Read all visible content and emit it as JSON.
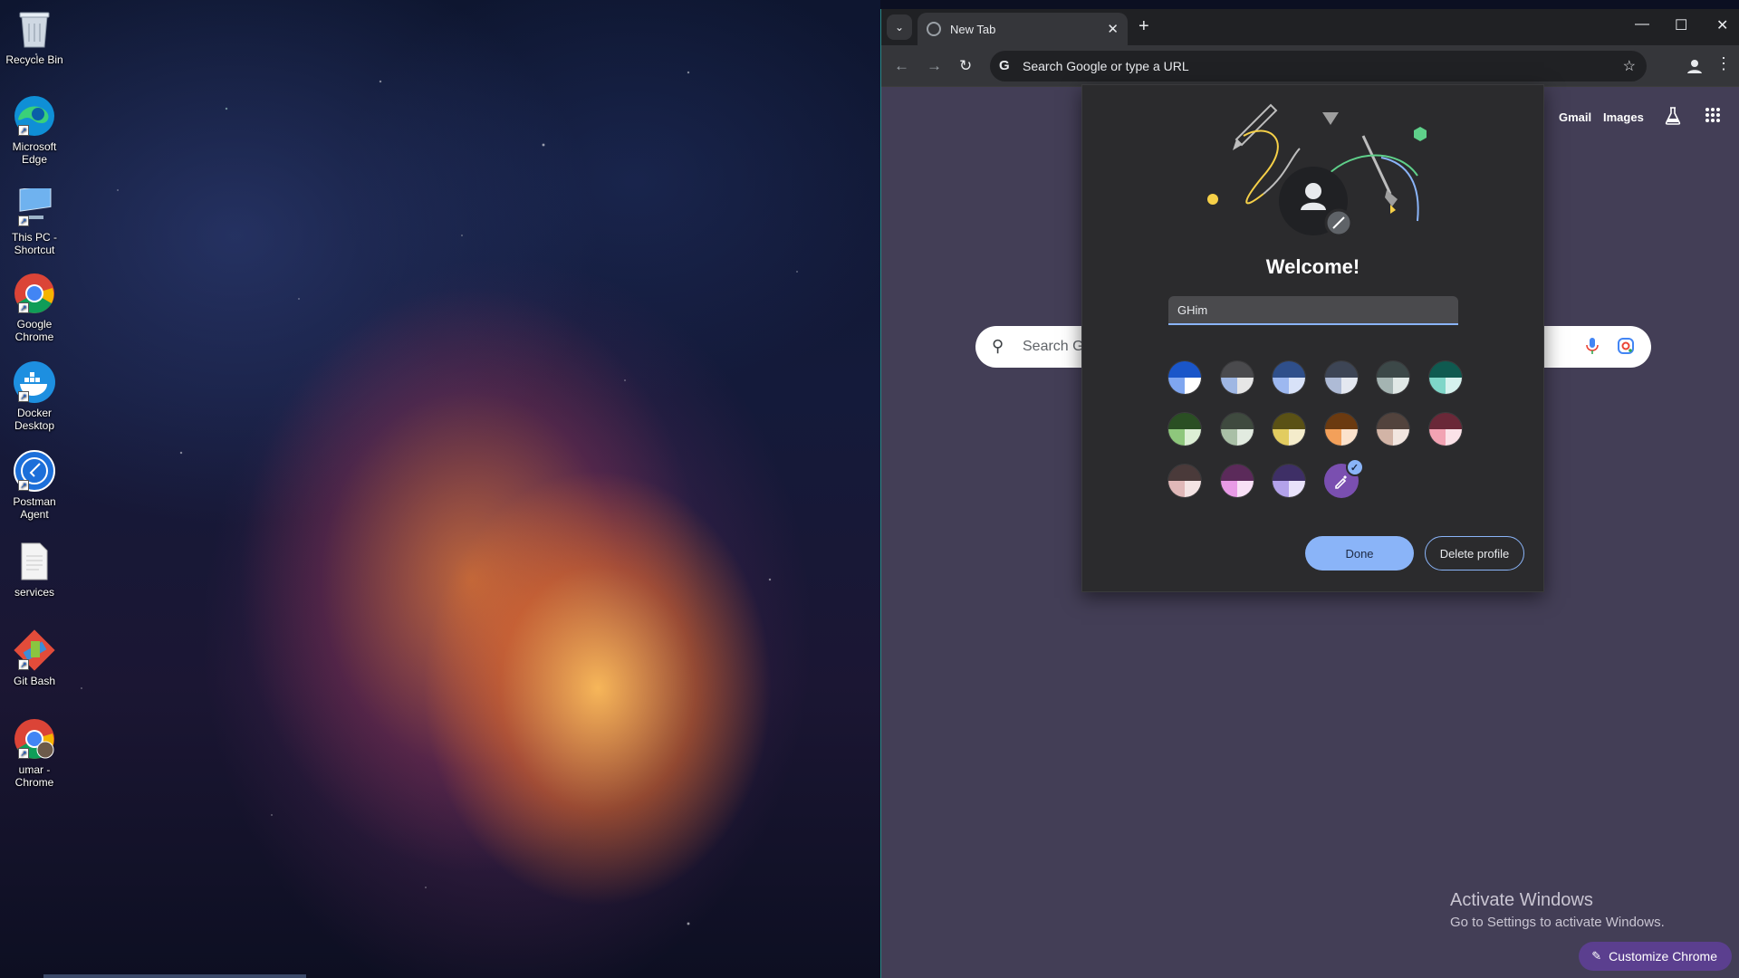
{
  "desktop": {
    "icons": [
      {
        "label": "Recycle Bin",
        "icon": "recycle-bin-icon"
      },
      {
        "label": "Microsoft Edge",
        "icon": "edge-icon"
      },
      {
        "label": "This PC - Shortcut",
        "icon": "computer-icon"
      },
      {
        "label": "Google Chrome",
        "icon": "chrome-icon"
      },
      {
        "label": "Docker Desktop",
        "icon": "docker-icon"
      },
      {
        "label": "Postman Agent",
        "icon": "postman-icon"
      },
      {
        "label": "services",
        "icon": "text-file-icon"
      },
      {
        "label": "Git Bash",
        "icon": "git-icon"
      },
      {
        "label": "umar - Chrome",
        "icon": "chrome-profile-icon"
      }
    ],
    "activate_windows": {
      "title": "Activate Windows",
      "subtitle": "Go to Settings to activate Windows."
    }
  },
  "browser": {
    "tab": {
      "title": "New Tab",
      "close": "✕"
    },
    "new_tab": "+",
    "window_controls": {
      "minimize": "—",
      "maximize": "☐",
      "close": "✕"
    },
    "omnibox": {
      "placeholder": "Search Google or type a URL"
    },
    "ntp": {
      "links": [
        "Gmail",
        "Images"
      ],
      "search_placeholder": "Search G",
      "customize_label": "Customize Chrome"
    }
  },
  "profile_dialog": {
    "title": "Welcome!",
    "name_value": "GHim",
    "color_swatches": [
      {
        "top": "#1a56c9",
        "bl": "#7fa6f0",
        "br": "#ffffff"
      },
      {
        "top": "#4a4a4d",
        "bl": "#9fb7e3",
        "br": "#e6e6e6"
      },
      {
        "top": "#2f4f8a",
        "bl": "#9db8f0",
        "br": "#d8e2f8"
      },
      {
        "top": "#3d4555",
        "bl": "#aebbd6",
        "br": "#e4e8f0"
      },
      {
        "top": "#3c4848",
        "bl": "#a4b4b2",
        "br": "#e0e8e6"
      },
      {
        "top": "#0f5a50",
        "bl": "#7fd6c8",
        "br": "#d6f2ee"
      },
      {
        "top": "#2a4f23",
        "bl": "#8ec77c",
        "br": "#dcefd5"
      },
      {
        "top": "#3f4a3f",
        "bl": "#a9bfa6",
        "br": "#e2ebe0"
      },
      {
        "top": "#5a5115",
        "bl": "#e2cc60",
        "br": "#f4eccb"
      },
      {
        "top": "#6b3a10",
        "bl": "#f3a05a",
        "br": "#fbe2cc"
      },
      {
        "top": "#52433d",
        "bl": "#d2b4a6",
        "br": "#f2e6e0"
      },
      {
        "top": "#6a2838",
        "bl": "#f2a3b3",
        "br": "#fbe2e8"
      },
      {
        "top": "#4a3a3a",
        "bl": "#e0b8b8",
        "br": "#f4e4e4"
      },
      {
        "top": "#5b2a5a",
        "bl": "#e89ae6",
        "br": "#f8e0f6"
      },
      {
        "top": "#3e2f66",
        "bl": "#b3a2ea",
        "br": "#e8e2fa"
      }
    ],
    "custom_color": "#7a4fb0",
    "buttons": {
      "done": "Done",
      "delete": "Delete profile"
    }
  }
}
